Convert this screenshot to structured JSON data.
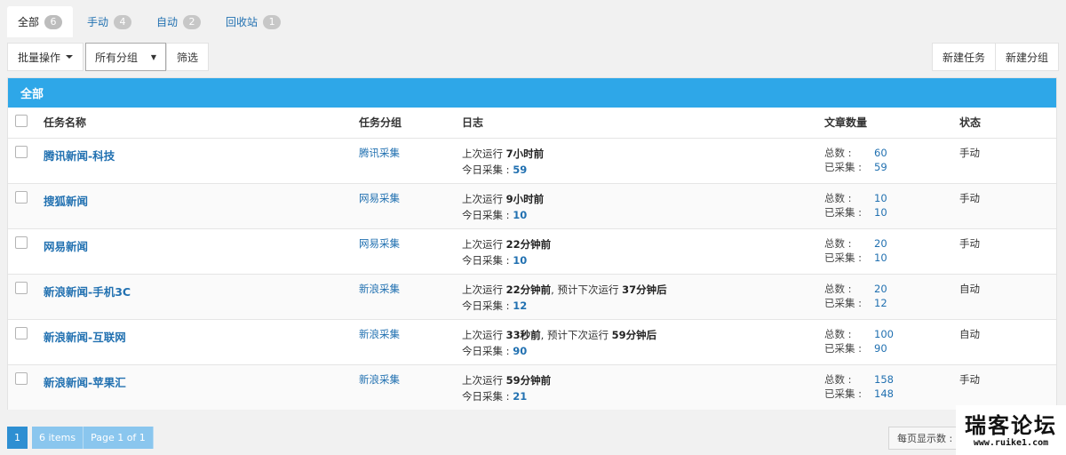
{
  "tabs": [
    {
      "label": "全部",
      "count": "6"
    },
    {
      "label": "手动",
      "count": "4"
    },
    {
      "label": "自动",
      "count": "2"
    },
    {
      "label": "回收站",
      "count": "1"
    }
  ],
  "toolbar": {
    "bulk_label": "批量操作",
    "group_select": "所有分组",
    "filter_label": "筛选",
    "new_task_label": "新建任务",
    "new_group_label": "新建分组"
  },
  "panel": {
    "title": "全部"
  },
  "table": {
    "headers": {
      "name": "任务名称",
      "group": "任务分组",
      "log": "日志",
      "count": "文章数量",
      "status": "状态"
    },
    "labels": {
      "last_run": "上次运行",
      "next_run": ", 预计下次运行",
      "today": "今日采集 :",
      "total": "总数 :",
      "collected": "已采集 :"
    },
    "rows": [
      {
        "name": "腾讯新闻-科技",
        "group": "腾讯采集",
        "last": "7小时前",
        "next": "",
        "today": "59",
        "total": "60",
        "collected": "59",
        "status": "手动"
      },
      {
        "name": "搜狐新闻",
        "group": "网易采集",
        "last": "9小时前",
        "next": "",
        "today": "10",
        "total": "10",
        "collected": "10",
        "status": "手动"
      },
      {
        "name": "网易新闻",
        "group": "网易采集",
        "last": "22分钟前",
        "next": "",
        "today": "10",
        "total": "20",
        "collected": "10",
        "status": "手动"
      },
      {
        "name": "新浪新闻-手机3C",
        "group": "新浪采集",
        "last": "22分钟前",
        "next": "37分钟后",
        "today": "12",
        "total": "20",
        "collected": "12",
        "status": "自动"
      },
      {
        "name": "新浪新闻-互联网",
        "group": "新浪采集",
        "last": "33秒前",
        "next": "59分钟后",
        "today": "90",
        "total": "100",
        "collected": "90",
        "status": "自动"
      },
      {
        "name": "新浪新闻-苹果汇",
        "group": "新浪采集",
        "last": "59分钟前",
        "next": "",
        "today": "21",
        "total": "158",
        "collected": "148",
        "status": "手动"
      }
    ]
  },
  "pagination": {
    "current": "1",
    "items": "6 items",
    "page": "Page 1 of 1",
    "per_page_label": "每页显示数 :"
  },
  "watermark": {
    "main": "瑞客论坛",
    "sub": "www.ruike1.com"
  }
}
